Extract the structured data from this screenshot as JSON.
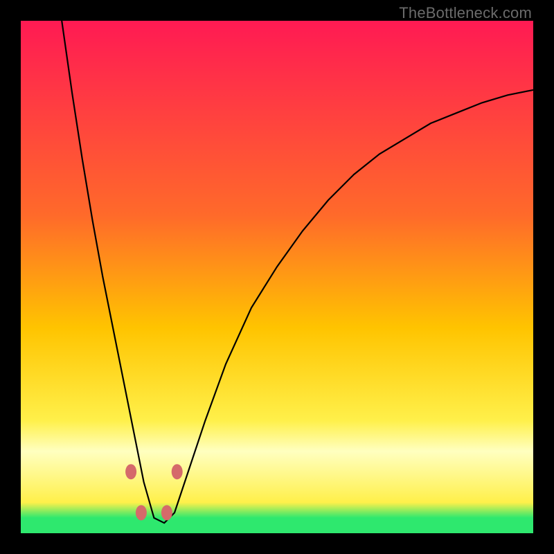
{
  "watermark": {
    "text": "TheBottleneck.com"
  },
  "colors": {
    "top": "#ff1a53",
    "mid1": "#ff6a2a",
    "mid2": "#ffc400",
    "mid3": "#fff04a",
    "pale": "#ffffc0",
    "green": "#2ee86e",
    "black": "#000000",
    "curve": "#000000",
    "dot": "#d56a6a"
  },
  "chart_data": {
    "type": "line",
    "title": "",
    "xlabel": "",
    "ylabel": "",
    "xlim": [
      0,
      100
    ],
    "ylim": [
      0,
      100
    ],
    "note": "x is relative horizontal position (0-100), y is bottleneck percentage (0 = no bottleneck / green, 100 = severe / red). Curve shows a V-shaped bottleneck profile with minimum near x≈25.",
    "series": [
      {
        "name": "bottleneck-curve",
        "x": [
          8,
          10,
          12,
          14,
          16,
          18,
          20,
          22,
          24,
          26,
          28,
          30,
          32,
          36,
          40,
          45,
          50,
          55,
          60,
          65,
          70,
          75,
          80,
          85,
          90,
          95,
          100
        ],
        "y": [
          100,
          86,
          73,
          61,
          50,
          40,
          30,
          20,
          10,
          3,
          2,
          4,
          10,
          22,
          33,
          44,
          52,
          59,
          65,
          70,
          74,
          77,
          80,
          82,
          84,
          85.5,
          86.5
        ]
      }
    ],
    "markers": [
      {
        "x": 21.5,
        "y": 12
      },
      {
        "x": 30.5,
        "y": 12
      },
      {
        "x": 23.5,
        "y": 4
      },
      {
        "x": 28.5,
        "y": 4
      }
    ],
    "gradient_stops_pct": [
      {
        "pct": 0,
        "key": "top"
      },
      {
        "pct": 38,
        "key": "mid1"
      },
      {
        "pct": 60,
        "key": "mid2"
      },
      {
        "pct": 78,
        "key": "mid3"
      },
      {
        "pct": 84,
        "key": "pale"
      },
      {
        "pct": 94,
        "key": "mid3"
      },
      {
        "pct": 97,
        "key": "green"
      },
      {
        "pct": 100,
        "key": "green"
      }
    ]
  }
}
